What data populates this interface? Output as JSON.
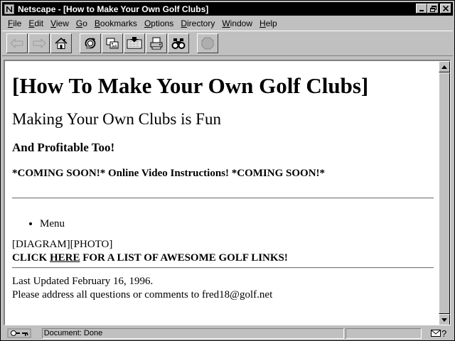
{
  "window": {
    "title": "Netscape - [How to Make Your Own Golf Clubs]",
    "icons": {
      "app": "netscape-n-icon",
      "minimize": "minimize-icon",
      "maximize": "restore-icon",
      "close": "close-icon"
    }
  },
  "menubar": {
    "items": [
      {
        "label": "File",
        "access": "F",
        "rest": "ile"
      },
      {
        "label": "Edit",
        "access": "E",
        "rest": "dit"
      },
      {
        "label": "View",
        "access": "V",
        "rest": "iew"
      },
      {
        "label": "Go",
        "access": "G",
        "rest": "o"
      },
      {
        "label": "Bookmarks",
        "access": "B",
        "rest": "ookmarks"
      },
      {
        "label": "Options",
        "access": "O",
        "rest": "ptions"
      },
      {
        "label": "Directory",
        "access": "D",
        "rest": "irectory"
      },
      {
        "label": "Window",
        "access": "W",
        "rest": "indow"
      },
      {
        "label": "Help",
        "access": "H",
        "rest": "elp"
      }
    ]
  },
  "toolbar": {
    "buttons": [
      {
        "icon": "back-arrow-icon",
        "enabled": false
      },
      {
        "icon": "forward-arrow-icon",
        "enabled": false
      },
      {
        "icon": "home-icon",
        "enabled": true
      },
      {
        "icon": "reload-icon",
        "enabled": true
      },
      {
        "icon": "images-icon",
        "enabled": true
      },
      {
        "icon": "open-icon",
        "enabled": true
      },
      {
        "icon": "print-icon",
        "enabled": true
      },
      {
        "icon": "find-icon",
        "enabled": true
      },
      {
        "icon": "stop-icon",
        "enabled": false
      }
    ]
  },
  "page": {
    "h1": "[How To Make Your Own Golf Clubs]",
    "h2": "Making Your Own Clubs is Fun",
    "h3": "And Profitable Too!",
    "h4": "*COMING SOON!* Online Video Instructions! *COMING SOON!*",
    "list": [
      "Menu"
    ],
    "image_placeholders": "[DIAGRAM][PHOTO]",
    "links_line": {
      "before": "CLICK ",
      "link": "HERE",
      "after": " FOR A LIST OF AWESOME GOLF LINKS!"
    },
    "last_updated": "Last Updated February 16, 1996.",
    "contact": "Please address all questions or comments to fred18@golf.net"
  },
  "statusbar": {
    "text": "Document: Done",
    "icons": {
      "security": "broken-key-icon",
      "mail": "mail-icon"
    },
    "mail_glyph": "?"
  }
}
